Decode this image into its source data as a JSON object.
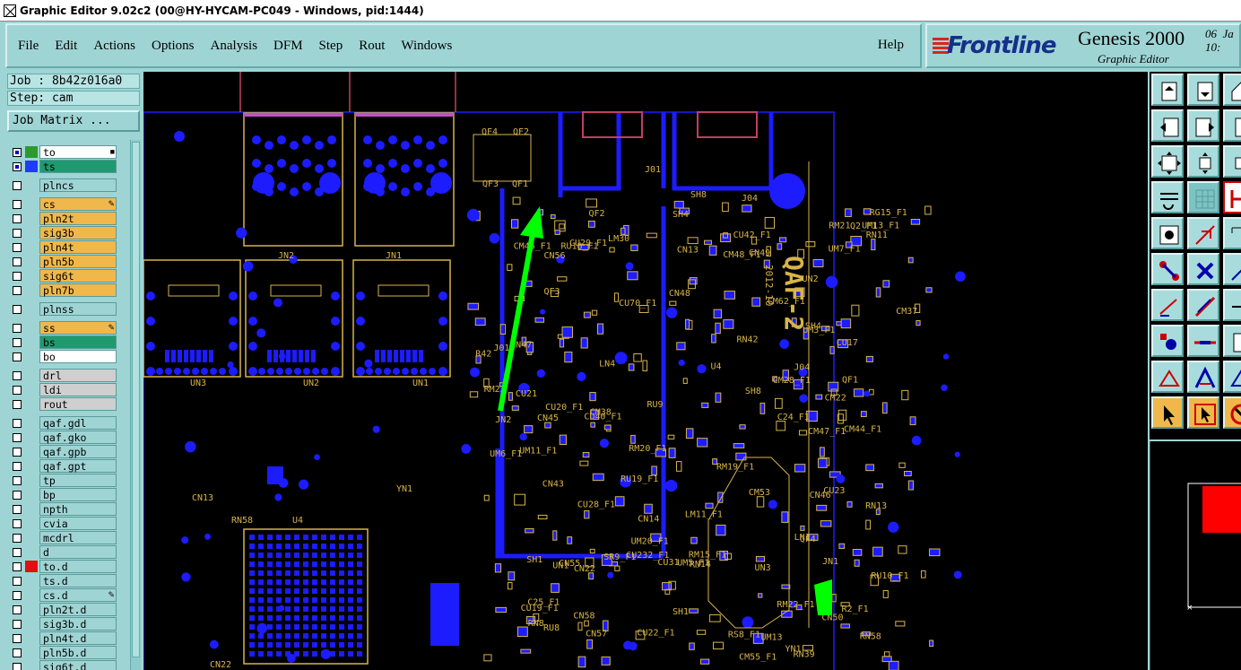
{
  "window": {
    "title": "Graphic Editor 9.02c2 (00@HY-HYCAM-PC049 - Windows, pid:1444)"
  },
  "menu": {
    "items": [
      {
        "id": "file",
        "label": "File"
      },
      {
        "id": "edit",
        "label": "Edit"
      },
      {
        "id": "actions",
        "label": "Actions"
      },
      {
        "id": "options",
        "label": "Options"
      },
      {
        "id": "analysis",
        "label": "Analysis"
      },
      {
        "id": "dfm",
        "label": "DFM"
      },
      {
        "id": "step",
        "label": "Step"
      },
      {
        "id": "rout",
        "label": "Rout"
      },
      {
        "id": "windows",
        "label": "Windows"
      }
    ],
    "help": "Help"
  },
  "brand": {
    "logo": "Frontline",
    "product": "Genesis 2000",
    "subtitle": "Graphic Editor",
    "clock": "06  Ja\n10:"
  },
  "info": {
    "job": "Job : 8b42z016a0",
    "step": "Step: cam",
    "job_matrix": "Job Matrix ..."
  },
  "layers": [
    {
      "name": "to",
      "fill": "#ffffff",
      "color": "#2e9a2e",
      "cb": "#0000cc",
      "mark": "■"
    },
    {
      "name": "ts",
      "fill": "#1f9a6e",
      "color": "#1e3cff",
      "cb": "#0000cc",
      "mark": ""
    },
    {
      "name": "plncs",
      "fill": "#9fd4d4",
      "color": "",
      "cb": "",
      "mark": ""
    },
    {
      "name": "cs",
      "fill": "#f0b84a",
      "color": "",
      "cb": "",
      "mark": "✎"
    },
    {
      "name": "pln2t",
      "fill": "#f0b84a",
      "color": "",
      "cb": "",
      "mark": ""
    },
    {
      "name": "sig3b",
      "fill": "#f0b84a",
      "color": "",
      "cb": "",
      "mark": ""
    },
    {
      "name": "pln4t",
      "fill": "#f0b84a",
      "color": "",
      "cb": "",
      "mark": ""
    },
    {
      "name": "pln5b",
      "fill": "#f0b84a",
      "color": "",
      "cb": "",
      "mark": ""
    },
    {
      "name": "sig6t",
      "fill": "#f0b84a",
      "color": "",
      "cb": "",
      "mark": ""
    },
    {
      "name": "pln7b",
      "fill": "#f0b84a",
      "color": "",
      "cb": "",
      "mark": ""
    },
    {
      "name": "plnss",
      "fill": "#9fd4d4",
      "color": "",
      "cb": "",
      "mark": ""
    },
    {
      "name": "ss",
      "fill": "#f0b84a",
      "color": "",
      "cb": "",
      "mark": "✎"
    },
    {
      "name": "bs",
      "fill": "#1f9a6e",
      "color": "",
      "cb": "",
      "mark": ""
    },
    {
      "name": "bo",
      "fill": "#ffffff",
      "color": "",
      "cb": "",
      "mark": ""
    },
    {
      "name": "drl",
      "fill": "#cfcfcf",
      "color": "",
      "cb": "",
      "mark": ""
    },
    {
      "name": "ldi",
      "fill": "#cfcfcf",
      "color": "",
      "cb": "",
      "mark": ""
    },
    {
      "name": "rout",
      "fill": "#cfcfcf",
      "color": "",
      "cb": "",
      "mark": ""
    },
    {
      "name": "qaf.gdl",
      "fill": "#9fd4d4",
      "color": "",
      "cb": "",
      "mark": ""
    },
    {
      "name": "qaf.gko",
      "fill": "#9fd4d4",
      "color": "",
      "cb": "",
      "mark": ""
    },
    {
      "name": "qaf.gpb",
      "fill": "#9fd4d4",
      "color": "",
      "cb": "",
      "mark": ""
    },
    {
      "name": "qaf.gpt",
      "fill": "#9fd4d4",
      "color": "",
      "cb": "",
      "mark": ""
    },
    {
      "name": "tp",
      "fill": "#9fd4d4",
      "color": "",
      "cb": "",
      "mark": ""
    },
    {
      "name": "bp",
      "fill": "#9fd4d4",
      "color": "",
      "cb": "",
      "mark": ""
    },
    {
      "name": "npth",
      "fill": "#9fd4d4",
      "color": "",
      "cb": "",
      "mark": ""
    },
    {
      "name": "cvia",
      "fill": "#9fd4d4",
      "color": "",
      "cb": "",
      "mark": ""
    },
    {
      "name": "mcdrl",
      "fill": "#9fd4d4",
      "color": "",
      "cb": "",
      "mark": ""
    },
    {
      "name": "d",
      "fill": "#9fd4d4",
      "color": "",
      "cb": "",
      "mark": ""
    },
    {
      "name": "to.d",
      "fill": "#9fd4d4",
      "color": "#e01010",
      "cb": "",
      "mark": ""
    },
    {
      "name": "ts.d",
      "fill": "#9fd4d4",
      "color": "",
      "cb": "",
      "mark": ""
    },
    {
      "name": "cs.d",
      "fill": "#9fd4d4",
      "color": "",
      "cb": "",
      "mark": "✎"
    },
    {
      "name": "pln2t.d",
      "fill": "#9fd4d4",
      "color": "",
      "cb": "",
      "mark": ""
    },
    {
      "name": "sig3b.d",
      "fill": "#9fd4d4",
      "color": "",
      "cb": "",
      "mark": ""
    },
    {
      "name": "pln4t.d",
      "fill": "#9fd4d4",
      "color": "",
      "cb": "",
      "mark": ""
    },
    {
      "name": "pln5b.d",
      "fill": "#9fd4d4",
      "color": "",
      "cb": "",
      "mark": ""
    },
    {
      "name": "sig6t.d",
      "fill": "#9fd4d4",
      "color": "",
      "cb": "",
      "mark": ""
    }
  ],
  "board": {
    "board_label": "QAF-2",
    "date_label": "2012-10",
    "labels": [
      "QF4",
      "QF2",
      "QF3",
      "QF1",
      "UN3",
      "UN2",
      "UN1",
      "JN2",
      "JN1",
      "J01",
      "J04",
      "SH8",
      "SH4",
      "SH1",
      "U4",
      "YN1",
      "CN13",
      "RN58",
      "CN22",
      "CN43",
      "UM6_F1",
      "CU42_F1",
      "LM11_F1",
      "CU40_F1",
      "RU18_F1",
      "CU23",
      "UM13_F1",
      "CU70_F1",
      "UM5_F1",
      "RU19_F1",
      "CU232_F1",
      "CM47_F1",
      "CM44_F1",
      "CM48_F1",
      "CM46_F1",
      "RM21",
      "RM20_F1",
      "RM22_F1",
      "RM19_F1",
      "RM23",
      "CM37",
      "RU9",
      "Q2_F1",
      "CM38",
      "UM13",
      "SR9_F1",
      "R2_F1",
      "C24_F1",
      "RS8_F1",
      "C25_F1",
      "CU17",
      "CU19_F1",
      "UM20_F1",
      "CU31",
      "RU8",
      "RU10_F1",
      "UM3_F1",
      "CU21",
      "CU20_F1",
      "CU29_F1",
      "CU28_F1",
      "CU22_F1",
      "UM11_F1",
      "RG15_F1",
      "RN13",
      "RN39",
      "RN14",
      "RN8",
      "RM15_F1",
      "LN4",
      "LM30",
      "CM62_F1",
      "CM55_F1",
      "CM22",
      "CM53",
      "UM7_F1",
      "R42",
      "CM28_F1",
      "CN57",
      "CN56",
      "CN55",
      "CN58",
      "CN49",
      "CN48",
      "CN47",
      "CN46",
      "CN50",
      "CN45",
      "RN11",
      "RN42",
      "LN1",
      "CN14"
    ],
    "arrow_color": "#00ff00",
    "pad_color": "#1c1cff",
    "silk_color": "#d7b44a",
    "minimap_view_color": "#ff0000"
  },
  "tools": [
    "zoom-page-top-icon",
    "zoom-page-down-icon",
    "home-icon",
    "pan-left-icon",
    "pan-right-icon",
    "pan-extra-icon",
    "fit-screen-icon",
    "zoom-center-icon",
    "zoom-extra-icon",
    "measure-icon",
    "grid-icon",
    "snap-icon",
    "select-feature-icon",
    "select-area-icon",
    "ruler-icon",
    "connect-icon",
    "cross-icon",
    "line-extra-icon",
    "draw-line-icon",
    "diagonal-line-icon",
    "arrow-extra-icon",
    "add-pad-icon",
    "horizontal-line-icon",
    "box-extra-icon",
    "polygon-icon",
    "triangle-icon",
    "polygon-extra-icon",
    "pointer-icon",
    "pointer-box-icon",
    "compass-icon"
  ]
}
